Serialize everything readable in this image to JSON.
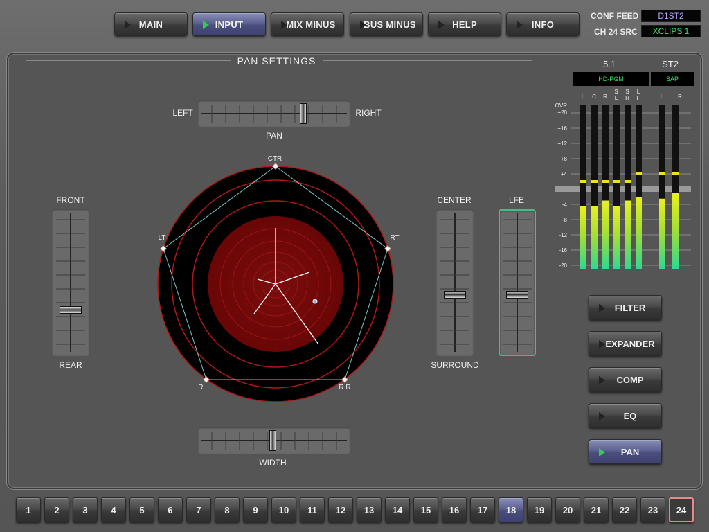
{
  "nav": {
    "tabs": [
      {
        "label": "MAIN",
        "active": false
      },
      {
        "label": "INPUT",
        "active": true
      },
      {
        "label": "MIX MINUS",
        "active": false
      },
      {
        "label": "BUS MINUS",
        "active": false
      },
      {
        "label": "HELP",
        "active": false
      },
      {
        "label": "INFO",
        "active": false
      }
    ]
  },
  "status": {
    "conf_feed_label": "CONF FEED",
    "conf_feed_value": "D1ST2",
    "ch_src_label": "CH 24 SRC",
    "ch_src_value": "XCLIPS 1",
    "conf_feed_color": "#b8a8ff",
    "ch_src_color": "#3ee070"
  },
  "pan_settings": {
    "title": "PAN SETTINGS",
    "pan": {
      "left_label": "LEFT",
      "right_label": "RIGHT",
      "caption": "PAN",
      "value": 0.72
    },
    "width": {
      "caption": "WIDTH",
      "value": 0.5
    },
    "front_rear": {
      "top_label": "FRONT",
      "bottom_label": "REAR",
      "value": 0.28
    },
    "center": {
      "top_label": "CENTER",
      "bottom_label": "SURROUND",
      "value": 0.44
    },
    "lfe": {
      "top_label": "LFE",
      "value": 0.44
    },
    "speakers": {
      "ctr": "CTR",
      "lt": "LT",
      "rt": "RT",
      "rl": "R L",
      "rr": "R R"
    }
  },
  "meters": {
    "group_51": "5.1",
    "group_st2": "ST2",
    "src_51": "HD-PGM",
    "src_st2": "SAP",
    "channels_51": [
      "L",
      "C",
      "R",
      "S\nL",
      "S\nR",
      "L\nF"
    ],
    "channels_st2": [
      "L",
      "R"
    ],
    "scale": [
      "OVR",
      "+20",
      "+16",
      "+12",
      "+8",
      "+4",
      "0",
      "-4",
      "-8",
      "-12",
      "-16",
      "-20"
    ],
    "levels_51": [
      -4.5,
      -4.5,
      -3,
      -4.5,
      -3,
      -2
    ],
    "levels_st2": [
      -2.5,
      -1
    ],
    "peak_51": [
      2,
      2,
      2,
      2,
      2,
      4
    ],
    "peak_st2": [
      4,
      4
    ]
  },
  "side_buttons": [
    {
      "label": "FILTER",
      "active": false
    },
    {
      "label": "EXPANDER",
      "active": false
    },
    {
      "label": "COMP",
      "active": false
    },
    {
      "label": "EQ",
      "active": false
    },
    {
      "label": "PAN",
      "active": true
    }
  ],
  "channels": [
    "1",
    "2",
    "3",
    "4",
    "5",
    "6",
    "7",
    "8",
    "9",
    "10",
    "11",
    "12",
    "13",
    "14",
    "15",
    "16",
    "17",
    "18",
    "19",
    "20",
    "21",
    "22",
    "23",
    "24"
  ],
  "selected_channel": "18",
  "current_channel": "24"
}
